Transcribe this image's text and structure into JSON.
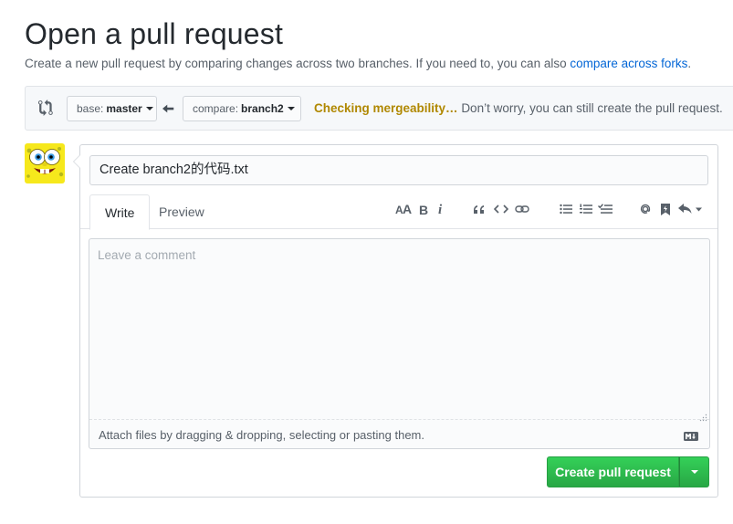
{
  "header": {
    "title": "Open a pull request",
    "subtitle_text": "Create a new pull request by comparing changes across two branches. If you need to, you can also",
    "subtitle_link": "compare across forks",
    "subtitle_end": "."
  },
  "range": {
    "base_label": "base:",
    "base_value": "master",
    "compare_label": "compare:",
    "compare_value": "branch2",
    "status_checking": "Checking mergeability…",
    "status_message": "Don’t worry, you can still create the pull request."
  },
  "form": {
    "title_value": "Create branch2的代码.txt",
    "tabs": [
      {
        "label": "Write",
        "active": true
      },
      {
        "label": "Preview",
        "active": false
      }
    ],
    "toolbar_icons": [
      "header-icon",
      "bold-icon",
      "italic-icon",
      "quote-icon",
      "code-icon",
      "link-icon",
      "unordered-list-icon",
      "ordered-list-icon",
      "task-list-icon",
      "mention-icon",
      "saved-reply-icon",
      "reply-icon"
    ],
    "comment_placeholder": "Leave a comment",
    "attach_text": "Attach files by dragging & dropping, selecting or pasting them.",
    "submit_label": "Create pull request"
  },
  "colors": {
    "primary_green": "#28a745",
    "link_blue": "#0366d6",
    "warning_text": "#b08800"
  }
}
